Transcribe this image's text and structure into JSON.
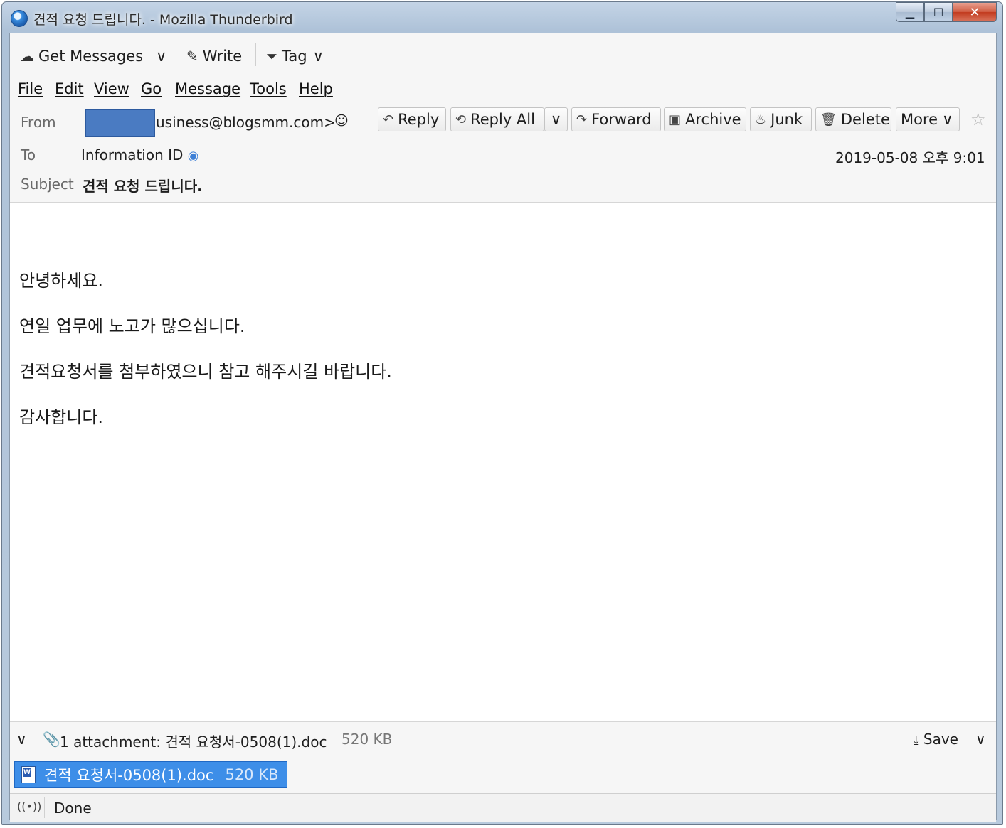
{
  "window": {
    "title": "견적 요청 드립니다. - Mozilla Thunderbird",
    "controls": {
      "minimize": "▁",
      "maximize": "☐",
      "close": "✕"
    }
  },
  "toolbar": {
    "get_messages": "Get Messages",
    "dropdown": "∨",
    "write": "Write",
    "tag": "Tag"
  },
  "menu": [
    "File",
    "Edit",
    "View",
    "Go",
    "Message",
    "Tools",
    "Help"
  ],
  "header": {
    "from_label": "From",
    "from_value": "usiness@blogsmm.com>",
    "to_label": "To",
    "to_value": "Information ID",
    "subject_label": "Subject",
    "subject_value": "견적 요청 드립니다.",
    "date": "2019-05-08 오후 9:01",
    "buttons": {
      "reply": "Reply",
      "reply_all": "Reply All",
      "forward": "Forward",
      "archive": "Archive",
      "junk": "Junk",
      "delete": "Delete",
      "more": "More"
    }
  },
  "body": {
    "lines": [
      "안녕하세요.",
      "연일 업무에 노고가 많으십니다.",
      "견적요청서를 첨부하였으니 참고 해주시길 바랍니다.",
      "감사합니다."
    ]
  },
  "attachments": {
    "summary": "1 attachment: 견적 요청서-0508(1).doc",
    "summary_size": "520 KB",
    "save": "Save",
    "items": [
      {
        "name": "견적 요청서-0508(1).doc",
        "size": "520 KB"
      }
    ]
  },
  "status": {
    "text": "Done"
  },
  "colors": {
    "accent": "#3d8ee8",
    "link_icon": "#3d7fd6"
  }
}
